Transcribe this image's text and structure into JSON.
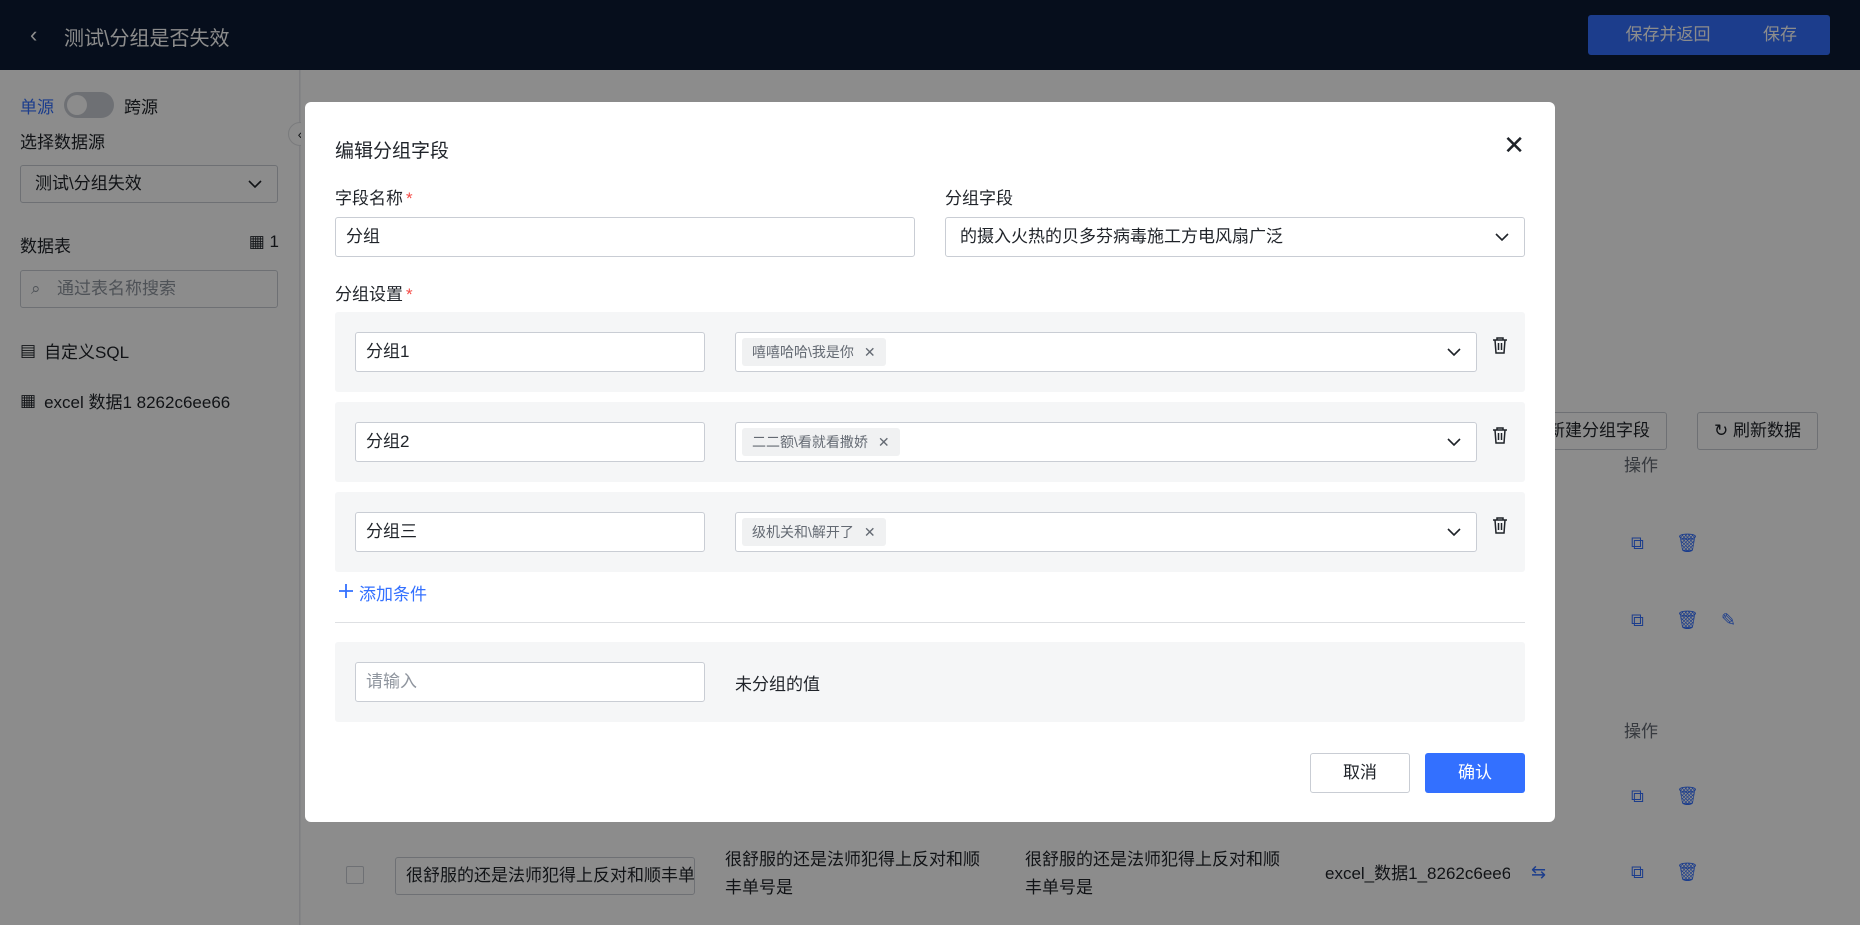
{
  "header": {
    "title": "测试\\分组是否失效",
    "save_return_label": "保存并返回",
    "save_label": "保存"
  },
  "sidebar": {
    "single_source": "单源",
    "cross_source": "跨源",
    "datasource_label": "选择数据源",
    "datasource_value": "测试\\分组失效",
    "tables_label": "数据表",
    "tables_count": "1",
    "search_placeholder": "通过表名称搜索",
    "items": [
      {
        "label": "自定义SQL"
      },
      {
        "label": "excel 数据1 8262c6ee66"
      }
    ]
  },
  "main": {
    "new_group_field": "新建分组字段",
    "refresh_data": "刷新数据",
    "col_header_op_1": "操作",
    "col_header_op_2": "操作",
    "row": {
      "input_value": "很舒服的还是法师犯得上反对和顺丰单号是",
      "cell_1": "很舒服的还是法师犯得上反对和顺丰单号是",
      "cell_2": "很舒服的还是法师犯得上反对和顺丰单号是",
      "cell_3": "excel_数据1_8262c6ee66"
    }
  },
  "modal": {
    "title": "编辑分组字段",
    "field_name_label": "字段名称",
    "field_name_value": "分组",
    "group_field_label": "分组字段",
    "group_field_value": "的摄入火热的贝多芬病毒施工方电风扇广泛",
    "group_settings_label": "分组设置",
    "groups": [
      {
        "name": "分组1",
        "tag": "嘻嘻哈哈\\我是你"
      },
      {
        "name": "分组2",
        "tag": "二二额\\看就看撒娇"
      },
      {
        "name": "分组三",
        "tag": "级机关和\\解开了"
      }
    ],
    "add_condition_label": "添加条件",
    "ungrouped_placeholder": "请输入",
    "ungrouped_label": "未分组的值",
    "cancel_label": "取消",
    "confirm_label": "确认"
  },
  "colors": {
    "accent": "#3370ff",
    "topbar": "#0b1b33",
    "required": "#f54a45"
  }
}
